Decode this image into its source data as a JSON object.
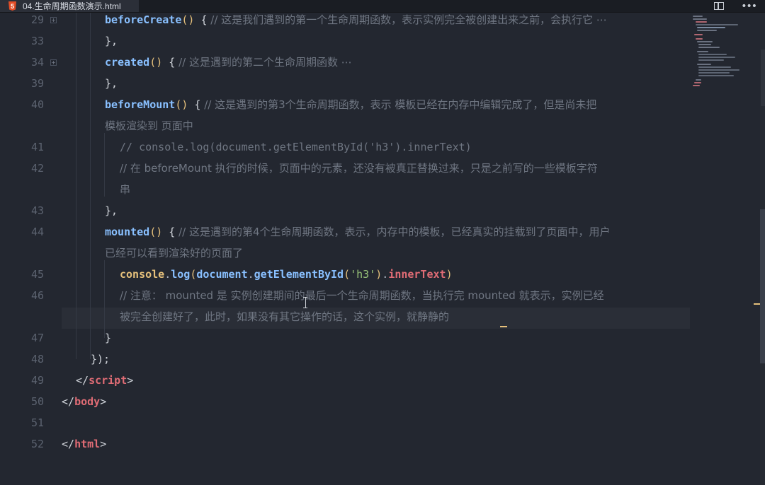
{
  "tab": {
    "icon": "html5-icon",
    "icon_glyph": "5",
    "title": "04.生命周期函数演示.html"
  },
  "toolbar": {
    "split_icon": "split-editor-icon",
    "more_glyph": "•••"
  },
  "editor": {
    "line_numbers": [
      "29",
      "33",
      "34",
      "39",
      "40",
      "",
      "41",
      "42",
      "",
      "43",
      "44",
      "",
      "45",
      "46",
      "",
      "47",
      "48",
      "49",
      "50",
      "51",
      "52"
    ],
    "lines": {
      "l29": {
        "fn": "beforeCreate",
        "paren": "()",
        "brace": " {",
        "comment": " // 这是我们遇到的第一个生命周期函数，表示实例完全被创建出来之前，会执行它 ⋯"
      },
      "l33": {
        "text": "},"
      },
      "l34": {
        "fn": "created",
        "paren": "()",
        "brace": " {",
        "comment": " // 这是遇到的第二个生命周期函数 ⋯"
      },
      "l39": {
        "text": "},"
      },
      "l40": {
        "fn": "beforeMount",
        "paren": "()",
        "brace": " {",
        "comment": " // 这是遇到的第3个生命周期函数，表示 模板已经在内存中编辑完成了，但是尚未把"
      },
      "l40b": {
        "comment": "模板渲染到 页面中"
      },
      "l41": {
        "comment": "// console.log(document.getElementById('h3').innerText)"
      },
      "l42": {
        "comment": "// 在 beforeMount 执行的时候，页面中的元素，还没有被真正替换过来，只是之前写的一些模板字符"
      },
      "l42b": {
        "comment": "串"
      },
      "l43": {
        "text": "},"
      },
      "l44": {
        "fn": "mounted",
        "paren": "()",
        "brace": " {",
        "comment": " // 这是遇到的第4个生命周期函数，表示，内存中的模板，已经真实的挂载到了页面中，用户"
      },
      "l44b": {
        "comment": "已经可以看到渲染好的页面了"
      },
      "l45": {
        "obj": "console",
        "dot1": ".",
        "meth": "log",
        "p1": "(",
        "obj2": "document",
        "dot2": ".",
        "meth2": "getElementById",
        "p2": "(",
        "str": "'h3'",
        "p3": ")",
        "dot3": ".",
        "prop": "innerText",
        "p4": ")"
      },
      "l46": {
        "comment": "// 注意： mounted 是 实例创建期间的最后一个生命周期函数，当执行完 mounted 就表示，实例已经"
      },
      "l46b": {
        "comment": "被完全创建好了，此时，如果没有其它操作的话，这个实例，就静静的"
      },
      "l47": {
        "text": "}"
      },
      "l48": {
        "text": "});"
      },
      "l49": {
        "open": "</",
        "tag": "script",
        "close": ">"
      },
      "l50": {
        "open": "</",
        "tag": "body",
        "close": ">"
      },
      "l52": {
        "open": "</",
        "tag": "html",
        "close": ">"
      }
    }
  },
  "colors": {
    "background": "#232730",
    "comment": "#6f7682",
    "function": "#89c0ff",
    "tag": "#e06c75",
    "string": "#98c379",
    "cursor": "#e5c07b"
  }
}
